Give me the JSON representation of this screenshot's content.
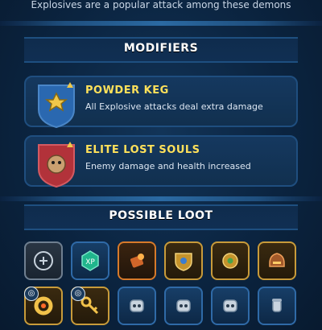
{
  "header": {
    "subtitle": "Explosives are a popular attack among these demons"
  },
  "sections": {
    "modifiers_title": "MODIFIERS",
    "loot_title": "POSSIBLE LOOT"
  },
  "modifiers": [
    {
      "title": "POWDER KEG",
      "description": "All Explosive attacks deal extra damage",
      "icon": "explosion-icon",
      "shield_color": "#2a68b0"
    },
    {
      "title": "ELITE LOST SOULS",
      "description": "Enemy damage and health increased",
      "icon": "demon-skull-icon",
      "shield_color": "#b2323a"
    }
  ],
  "loot": [
    {
      "icon": "emblem-icon",
      "style": "gray"
    },
    {
      "icon": "xp-icon",
      "style": "blue",
      "label": "XP"
    },
    {
      "icon": "explosive-charge-icon",
      "style": "orange"
    },
    {
      "icon": "gold-shield-icon",
      "style": "gold"
    },
    {
      "icon": "gold-gear-icon",
      "style": "gold"
    },
    {
      "icon": "bronze-helmet-icon",
      "style": "gold"
    },
    {
      "icon": "golden-ring-icon",
      "style": "gold"
    },
    {
      "icon": "golden-key-icon",
      "style": "gold"
    },
    {
      "icon": "robot-head-icon",
      "style": "blue"
    },
    {
      "icon": "robot-head-icon",
      "style": "blue"
    },
    {
      "icon": "robot-head-icon",
      "style": "blue"
    },
    {
      "icon": "gauntlet-icon",
      "style": "blue"
    }
  ]
}
